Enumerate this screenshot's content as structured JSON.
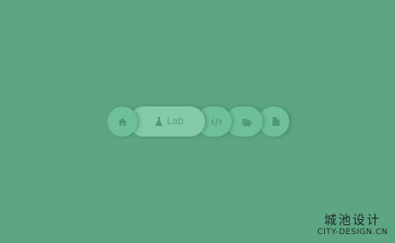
{
  "nav": {
    "items": [
      {
        "id": "home",
        "icon": "home-icon",
        "label": ""
      },
      {
        "id": "lab",
        "icon": "flask-icon",
        "label": "Lab",
        "active": true
      },
      {
        "id": "code",
        "icon": "code-icon",
        "label": ""
      },
      {
        "id": "folder",
        "icon": "folder-open-icon",
        "label": ""
      },
      {
        "id": "file",
        "icon": "file-icon",
        "label": ""
      }
    ]
  },
  "watermark": {
    "chinese": "城池设计",
    "domain": "CITY-DESIGN.CN"
  },
  "colors": {
    "background": "#5da584",
    "pill": "#6fbf9a",
    "pill_active": "#82caa9",
    "icon": "#4f9878",
    "watermark": "#1e2a25"
  }
}
